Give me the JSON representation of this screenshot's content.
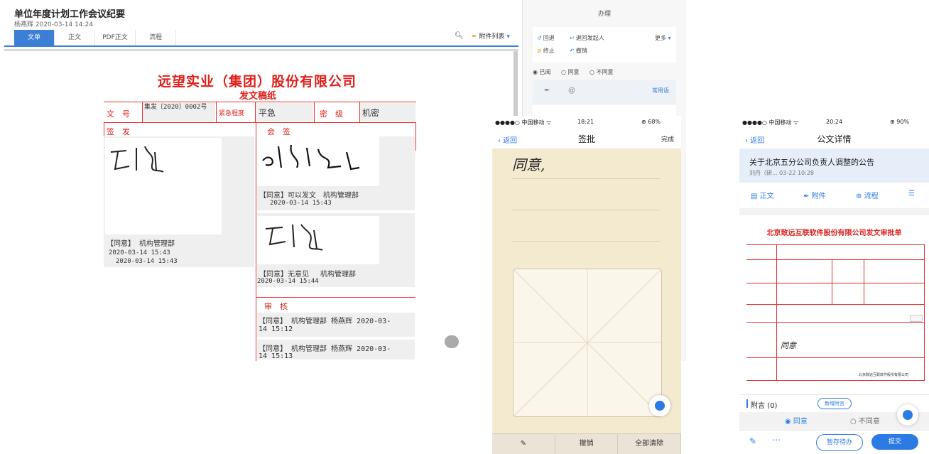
{
  "desktop": {
    "title": "单位年度计划工作会议纪要",
    "meta": "杨燕辉 2020-03-14 14:24",
    "tabs": [
      "文单",
      "正文",
      "PDF正文",
      "流程"
    ],
    "attachments_label": "附件列表",
    "document": {
      "company": "远望实业（集团）股份有限公司",
      "subtitle": "发文稿纸",
      "doc_no_label": "文　号",
      "doc_no_value": "集发〔2020〕0002号",
      "urgency_label": "紧急程度",
      "urgency_value": "平急",
      "secret_label": "密　级",
      "secret_value": "机密",
      "sign_label": "签　发",
      "countersign_label": "会　签",
      "sign_opinion": "【同意】 机构管理部",
      "sign_date1": "2020-03-14 15:43",
      "sign_date2": "2020-03-14 15:43",
      "cs1_opinion": "【同意】可以发文　机构管理部",
      "cs1_date": "2020-03-14 15:43",
      "cs2_opinion": "【同意】无意见　 机构管理部",
      "cs2_date": "2020-03-14 15:44",
      "review_label": "审　核",
      "review1_line1": "【同意】 机构管理部 杨燕辉 2020-03-",
      "review1_line2": "14 15:12",
      "review2_line1": "【同意】 机构管理部 杨燕辉 2020-03-",
      "review2_line2": "14 15:13"
    },
    "panel": {
      "header": "办理",
      "actions": [
        "回退",
        "退回发起人",
        "终止",
        "撤销"
      ],
      "more": "更多",
      "radios": [
        "已阅",
        "同意",
        "不同意"
      ],
      "common_phrases": "常用语"
    }
  },
  "phone1": {
    "status_carrier": "●●●●○ 中国移动 ᯤ",
    "status_time": "18:21",
    "status_battery": "⊕ 68%",
    "back": "返回",
    "title": "签批",
    "done": "完成",
    "handwriting": "同意,",
    "footer": [
      "撤销",
      "全部清除"
    ]
  },
  "phone2": {
    "status_carrier": "●●●●○ 中国移动 ᯤ",
    "status_time": "20:24",
    "status_battery": "⊕ 90%",
    "back": "返回",
    "title": "公文详情",
    "notice_title": "关于北京五分公司负责人调整的公告",
    "notice_meta": "刘丹（研...  03-22 10:28",
    "tabs": [
      "正文",
      "附件",
      "流程"
    ],
    "doc_title": "北京致远互联软件股份有限公司发文审批单",
    "doc_footer": "北京致远互联软件股份有限公司",
    "handwriting": "同意",
    "attach_label": "附言 (0)",
    "new_attach": "新增附言",
    "agree": "同意",
    "disagree": "不同意",
    "save_pending": "暂存待办",
    "submit": "提交"
  }
}
